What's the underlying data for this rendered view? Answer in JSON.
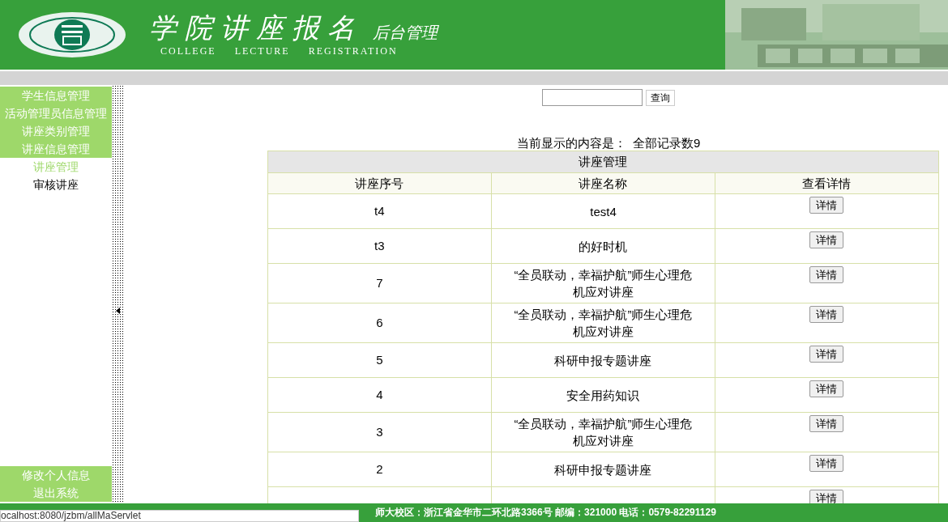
{
  "header": {
    "title": "学院讲座报名",
    "subtitle": "后台管理",
    "english": "COLLEGE LECTURE REGISTRATION"
  },
  "sidebar": {
    "items": [
      {
        "label": "学生信息管理",
        "kind": "menu"
      },
      {
        "label": "活动管理员信息管理",
        "kind": "menu"
      },
      {
        "label": "讲座类别管理",
        "kind": "menu"
      },
      {
        "label": "讲座信息管理",
        "kind": "menu"
      },
      {
        "label": "讲座管理",
        "kind": "sub",
        "selected": true
      },
      {
        "label": "审核讲座",
        "kind": "sub",
        "selected": false
      }
    ],
    "bottom_items": [
      "修改个人信息",
      "退出系统"
    ]
  },
  "search": {
    "button": "查询"
  },
  "summary": "当前显示的内容是：  全部记录数9",
  "table": {
    "title": "讲座管理",
    "columns": [
      "讲座序号",
      "讲座名称",
      "查看详情"
    ],
    "rows": [
      {
        "number": "t4",
        "name": "test4",
        "button": "详情"
      },
      {
        "number": "t3",
        "name": "的好时机",
        "button": "详情"
      },
      {
        "number": "7",
        "name": "“全员联动，幸福护航”师生心理危机应对讲座",
        "button": "详情"
      },
      {
        "number": "6",
        "name": "“全员联动，幸福护航”师生心理危机应对讲座",
        "button": "详情"
      },
      {
        "number": "5",
        "name": "科研申报专题讲座",
        "button": "详情"
      },
      {
        "number": "4",
        "name": "安全用药知识",
        "button": "详情"
      },
      {
        "number": "3",
        "name": "“全员联动，幸福护航”师生心理危机应对讲座",
        "button": "详情"
      },
      {
        "number": "2",
        "name": "科研申报专题讲座",
        "button": "详情"
      },
      {
        "button": "详情"
      }
    ]
  },
  "footer": {
    "address": "师大校区：浙江省金华市二环北路3366号 邮编：321000 电话：0579-82291129"
  },
  "status_url": "ocalhost:8080/jzbm/allMaServlet"
}
